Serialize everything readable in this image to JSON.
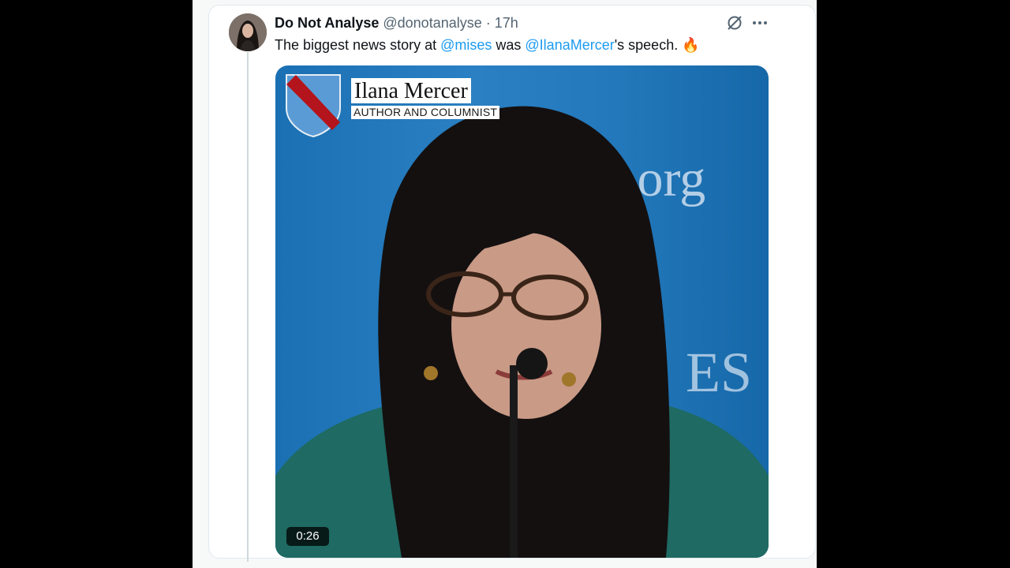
{
  "tweet": {
    "display_name": "Do Not Analyse",
    "handle": "@donotanalyse",
    "separator": "·",
    "time": "17h",
    "text_1": "The biggest news story at ",
    "mention_1": "@mises",
    "text_2": " was ",
    "mention_2": "@IlanaMercer",
    "text_3": "'s speech. ",
    "emoji": "🔥"
  },
  "icons": {
    "grok": "grok-icon",
    "more": "more-icon",
    "fire": "fire-emoji"
  },
  "video": {
    "name_title": "Ilana Mercer",
    "subtitle": "AUTHOR AND COLUMNIST",
    "background_text_1": ".org",
    "background_text_2": "ES",
    "duration": "0:26"
  },
  "colors": {
    "accent": "#1d9bf0",
    "text": "#0f1419",
    "secondary": "#536471",
    "video_bg": "#1f75b8"
  }
}
